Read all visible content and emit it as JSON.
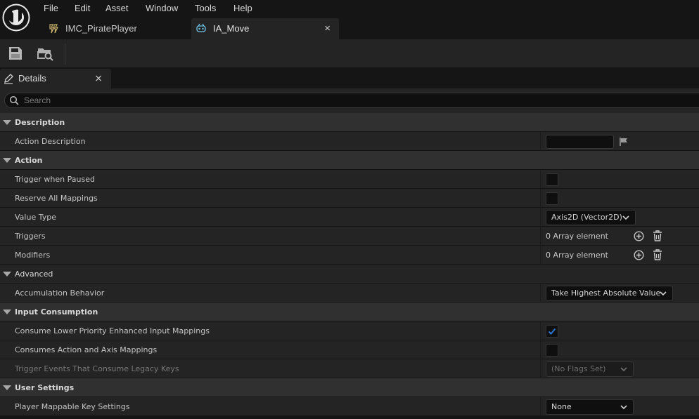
{
  "menu": [
    "File",
    "Edit",
    "Asset",
    "Window",
    "Tools",
    "Help"
  ],
  "tabs": [
    {
      "label": "IMC_PiratePlayer",
      "active": false
    },
    {
      "label": "IA_Move",
      "active": true
    }
  ],
  "tab_close_glyph": "×",
  "toolbar": {
    "buttons": [
      "save-icon",
      "browse-to-asset-icon"
    ]
  },
  "panel": {
    "tab_label": "Details",
    "close_glyph": "×"
  },
  "search": {
    "placeholder": "Search",
    "value": ""
  },
  "sections": {
    "description": {
      "label": "Description",
      "action_description": {
        "label": "Action Description",
        "value": ""
      }
    },
    "action": {
      "label": "Action",
      "trigger_when_paused": {
        "label": "Trigger when Paused",
        "checked": false
      },
      "reserve_all_mappings": {
        "label": "Reserve All Mappings",
        "checked": false
      },
      "value_type": {
        "label": "Value Type",
        "value": "Axis2D (Vector2D)"
      },
      "triggers": {
        "label": "Triggers",
        "value": "0 Array element"
      },
      "modifiers": {
        "label": "Modifiers",
        "value": "0 Array element"
      }
    },
    "advanced": {
      "label": "Advanced",
      "accumulation_behavior": {
        "label": "Accumulation Behavior",
        "value": "Take Highest Absolute Value"
      }
    },
    "input_consumption": {
      "label": "Input Consumption",
      "consume_lower": {
        "label": "Consume Lower Priority Enhanced Input Mappings",
        "checked": true
      },
      "consumes_action_axis": {
        "label": "Consumes Action and Axis Mappings",
        "checked": false
      },
      "trigger_events_legacy": {
        "label": "Trigger Events That Consume Legacy Keys",
        "value": "(No Flags Set)",
        "enabled": false
      }
    },
    "user_settings": {
      "label": "User Settings",
      "player_mappable": {
        "label": "Player Mappable Key Settings",
        "value": "None"
      }
    }
  },
  "colors": {
    "accent_check": "#2a78d4",
    "background": "#242424",
    "category": "#303030"
  }
}
